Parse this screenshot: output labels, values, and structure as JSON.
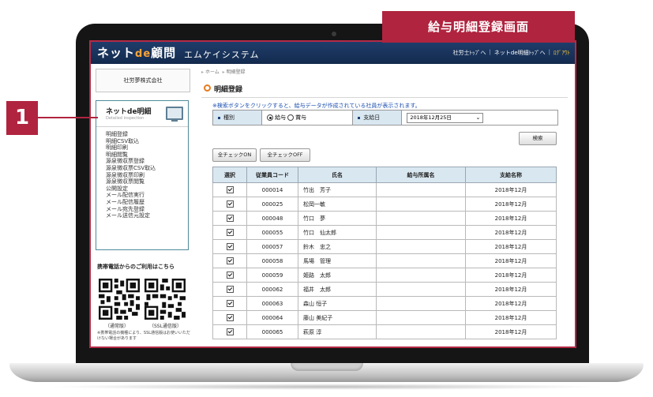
{
  "banner": {
    "title": "給与明細登録画面"
  },
  "callout": {
    "number": "1"
  },
  "app": {
    "logo_pre": "ネット",
    "logo_de": "de",
    "logo_post": "顧問",
    "system_name": "エムケイシステム",
    "links": [
      "社労士ﾄｯﾌﾟへ",
      "ネットde明細ﾄｯﾌﾟへ",
      "ﾛｸﾞｱｳﾄ"
    ]
  },
  "sidebar": {
    "company": "社労夢株式会社",
    "menu_title": "ネットde明細",
    "menu_subtitle": "Detailed inspection",
    "items": [
      "明細登録",
      "明細CSV取込",
      "明細印刷",
      "明細閲覧",
      "源泉徴収票登録",
      "源泉徴収票CSV取込",
      "源泉徴収票印刷",
      "源泉徴収票閲覧",
      "公開設定",
      "メール配信実行",
      "メール配信履歴",
      "メール宛先登録",
      "メール送信元設定"
    ],
    "qr_title": "携帯電話からのご利用はこちら",
    "qr_caption_1": "（通常版）",
    "qr_caption_2": "（SSL通信版）",
    "qr_note": "※携帯電話の機種により、SSL通信版はお使いいただけない場合があります"
  },
  "main": {
    "breadcrumb_home": "ホーム",
    "breadcrumb_current": "明細登録",
    "page_title": "明細登録",
    "notice": "※検索ボタンをクリックすると、給与データが作成されている社員が表示されます。",
    "filter": {
      "kind_label": "種別",
      "kind_option_1": "給与",
      "kind_option_2": "賞与",
      "date_label": "支給日",
      "date_value": "2018年12月25日"
    },
    "search_button": "検索",
    "check_all_on": "全チェックON",
    "check_all_off": "全チェックOFF",
    "table": {
      "headers": [
        "選択",
        "従業員コード",
        "氏名",
        "給与所属名",
        "支給名称"
      ],
      "rows": [
        {
          "code": "000014",
          "name": "竹出　芳子",
          "dept": "",
          "pay": "2018年12月"
        },
        {
          "code": "000025",
          "name": "松岡一敏",
          "dept": "",
          "pay": "2018年12月"
        },
        {
          "code": "000048",
          "name": "竹口　夢",
          "dept": "",
          "pay": "2018年12月"
        },
        {
          "code": "000055",
          "name": "竹口　仙太郎",
          "dept": "",
          "pay": "2018年12月"
        },
        {
          "code": "000057",
          "name": "鈴木　忠之",
          "dept": "",
          "pay": "2018年12月"
        },
        {
          "code": "000058",
          "name": "馬場　管理",
          "dept": "",
          "pay": "2018年12月"
        },
        {
          "code": "000059",
          "name": "姫路　太郎",
          "dept": "",
          "pay": "2018年12月"
        },
        {
          "code": "000062",
          "name": "福井　太郎",
          "dept": "",
          "pay": "2018年12月"
        },
        {
          "code": "000063",
          "name": "森山 恒子",
          "dept": "",
          "pay": "2018年12月"
        },
        {
          "code": "000064",
          "name": "藤山 美紀子",
          "dept": "",
          "pay": "2018年12月"
        },
        {
          "code": "000065",
          "name": "萩原 淳",
          "dept": "",
          "pay": "2018年12月"
        }
      ]
    }
  }
}
